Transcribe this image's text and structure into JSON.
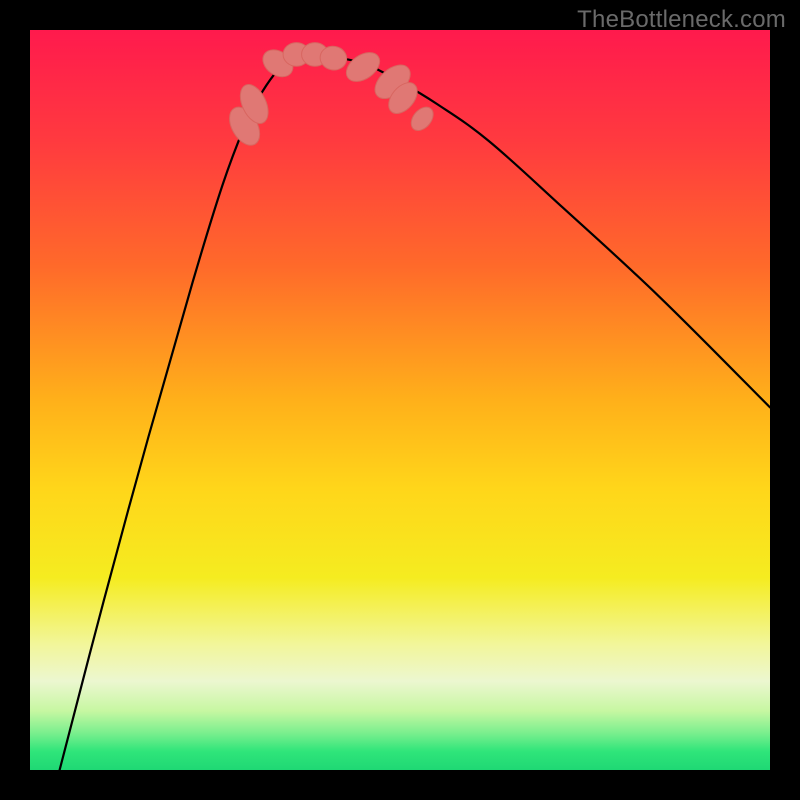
{
  "watermark": "TheBottleneck.com",
  "colors": {
    "frame_bg": "#000000",
    "watermark_text": "#6a6a6a",
    "curve_stroke": "#000000",
    "marker_fill": "#e07874",
    "marker_stroke": "#d86660"
  },
  "gradient_stops": [
    {
      "offset": 0.0,
      "color": "#ff1a4d"
    },
    {
      "offset": 0.15,
      "color": "#ff3a3f"
    },
    {
      "offset": 0.32,
      "color": "#ff6a2a"
    },
    {
      "offset": 0.5,
      "color": "#ffb01a"
    },
    {
      "offset": 0.62,
      "color": "#ffd61a"
    },
    {
      "offset": 0.74,
      "color": "#f5ec20"
    },
    {
      "offset": 0.83,
      "color": "#f2f69a"
    },
    {
      "offset": 0.88,
      "color": "#ecf7d0"
    },
    {
      "offset": 0.92,
      "color": "#c7f7a2"
    },
    {
      "offset": 0.95,
      "color": "#7aef8e"
    },
    {
      "offset": 0.975,
      "color": "#2fe57a"
    },
    {
      "offset": 1.0,
      "color": "#1fd874"
    }
  ],
  "chart_data": {
    "type": "line",
    "title": "",
    "xlabel": "",
    "ylabel": "",
    "xlim": [
      0,
      1
    ],
    "ylim": [
      0,
      1
    ],
    "series": [
      {
        "name": "bottleneck-curve",
        "x": [
          0.04,
          0.1,
          0.16,
          0.22,
          0.26,
          0.29,
          0.31,
          0.33,
          0.345,
          0.36,
          0.375,
          0.4,
          0.45,
          0.5,
          0.55,
          0.62,
          0.72,
          0.85,
          1.0
        ],
        "y": [
          0.0,
          0.23,
          0.45,
          0.66,
          0.79,
          0.87,
          0.91,
          0.94,
          0.955,
          0.965,
          0.97,
          0.965,
          0.955,
          0.93,
          0.9,
          0.85,
          0.76,
          0.64,
          0.49
        ]
      }
    ],
    "markers": [
      {
        "cx": 0.29,
        "cy": 0.87,
        "rx": 0.017,
        "ry": 0.028,
        "rot": -30
      },
      {
        "cx": 0.303,
        "cy": 0.9,
        "rx": 0.016,
        "ry": 0.028,
        "rot": -25
      },
      {
        "cx": 0.335,
        "cy": 0.955,
        "rx": 0.016,
        "ry": 0.022,
        "rot": -55
      },
      {
        "cx": 0.36,
        "cy": 0.967,
        "rx": 0.018,
        "ry": 0.016,
        "rot": 0
      },
      {
        "cx": 0.385,
        "cy": 0.967,
        "rx": 0.018,
        "ry": 0.016,
        "rot": 0
      },
      {
        "cx": 0.41,
        "cy": 0.962,
        "rx": 0.018,
        "ry": 0.016,
        "rot": 10
      },
      {
        "cx": 0.45,
        "cy": 0.95,
        "rx": 0.016,
        "ry": 0.025,
        "rot": 55
      },
      {
        "cx": 0.49,
        "cy": 0.93,
        "rx": 0.017,
        "ry": 0.028,
        "rot": 48
      },
      {
        "cx": 0.504,
        "cy": 0.908,
        "rx": 0.015,
        "ry": 0.024,
        "rot": 40
      },
      {
        "cx": 0.53,
        "cy": 0.88,
        "rx": 0.012,
        "ry": 0.018,
        "rot": 40
      }
    ]
  }
}
